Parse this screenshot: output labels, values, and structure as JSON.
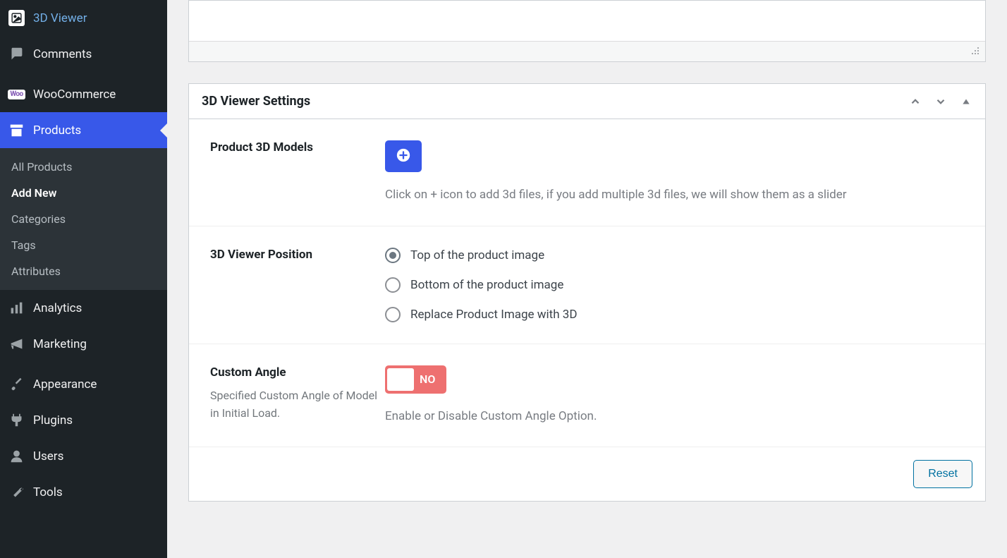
{
  "sidebar": {
    "items": {
      "viewer3d": "3D Viewer",
      "comments": "Comments",
      "woocommerce": "WooCommerce",
      "products": "Products",
      "analytics": "Analytics",
      "marketing": "Marketing",
      "appearance": "Appearance",
      "plugins": "Plugins",
      "users": "Users",
      "tools": "Tools"
    },
    "submenu": {
      "all_products": "All Products",
      "add_new": "Add New",
      "categories": "Categories",
      "tags": "Tags",
      "attributes": "Attributes"
    },
    "woo_badge": "Woo"
  },
  "metabox": {
    "title": "3D Viewer Settings"
  },
  "settings": {
    "models": {
      "label": "Product 3D Models",
      "help": "Click on + icon to add 3d files, if you add multiple 3d files, we will show them as a slider"
    },
    "position": {
      "label": "3D Viewer Position",
      "options": {
        "top": "Top of the product image",
        "bottom": "Bottom of the product image",
        "replace": "Replace Product Image with 3D"
      }
    },
    "custom_angle": {
      "label": "Custom Angle",
      "desc": "Specified Custom Angle of Model in Initial Load.",
      "toggle_text": "NO",
      "help": "Enable or Disable Custom Angle Option."
    }
  },
  "actions": {
    "reset": "Reset"
  }
}
